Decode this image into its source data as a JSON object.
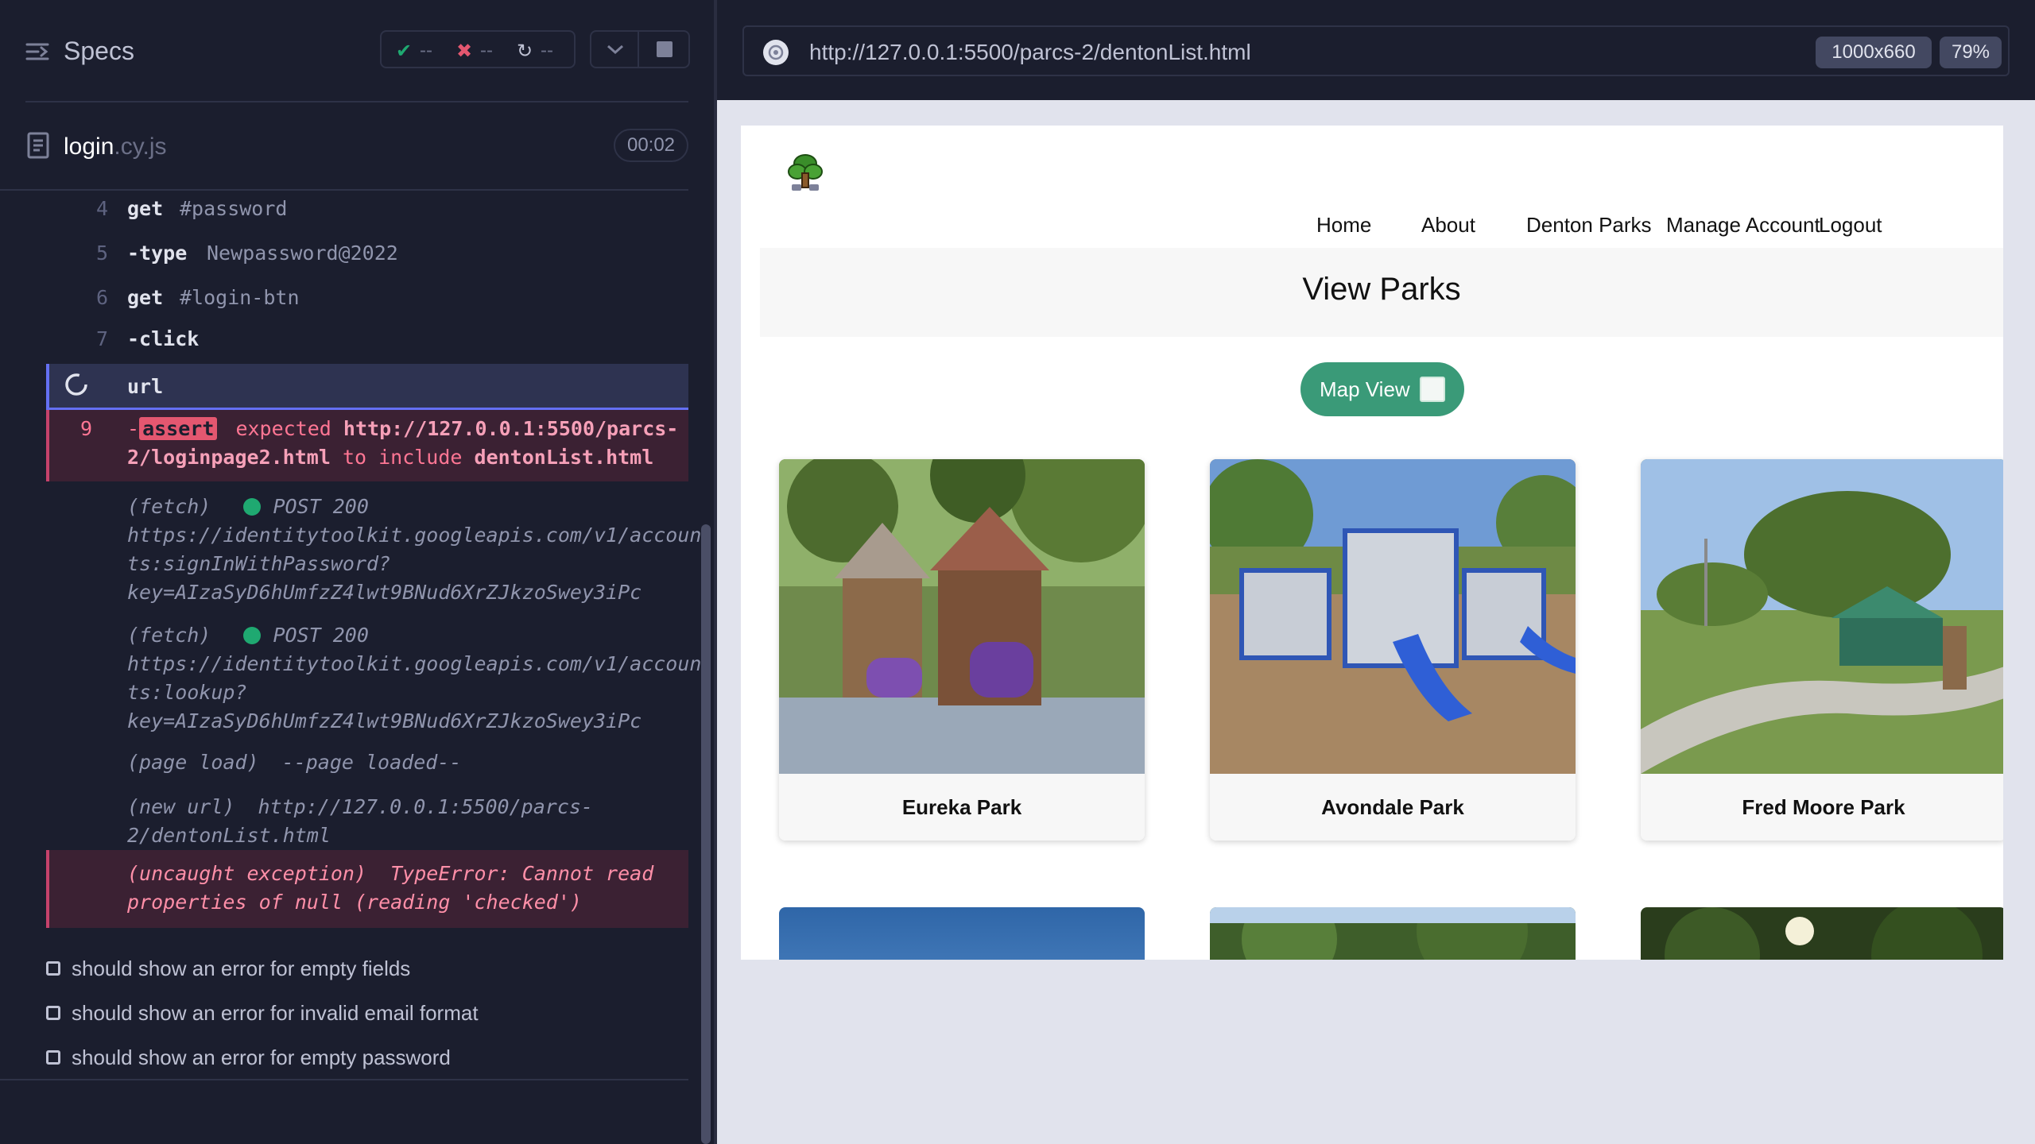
{
  "runner": {
    "specs_title": "Specs",
    "stats": {
      "passed": "--",
      "failed": "--",
      "pending": "--"
    },
    "file": {
      "name": "login",
      "ext": ".cy.js"
    },
    "timer": "00:02"
  },
  "commands": [
    {
      "num": "4",
      "name": "get",
      "arg": "#password"
    },
    {
      "num": "5",
      "name": "-type",
      "arg": "Newpassword@2022"
    },
    {
      "num": "6",
      "name": "get",
      "arg": "#login-btn"
    },
    {
      "num": "7",
      "name": "-click",
      "arg": ""
    },
    {
      "num": "",
      "name": "url",
      "arg": ""
    }
  ],
  "assert": {
    "num": "9",
    "dash": "-",
    "tag": "assert",
    "word_expected": "expected",
    "url_line1": "http://127.0.0.1:5500/parcs-",
    "url_line2": "2/loginpage2.html",
    "word_include": "to include",
    "target": "dentonList.html"
  },
  "logs": [
    {
      "type": "(fetch)",
      "status": "POST 200",
      "lines": [
        "https://identitytoolkit.googleapis.com/v1/accoun",
        "ts:signInWithPassword?",
        "key=AIzaSyD6hUmfzZ4lwt9BNud6XrZJkzoSwey3iPc"
      ]
    },
    {
      "type": "(fetch)",
      "status": "POST 200",
      "lines": [
        "https://identitytoolkit.googleapis.com/v1/accoun",
        "ts:lookup?",
        "key=AIzaSyD6hUmfzZ4lwt9BNud6XrZJkzoSwey3iPc"
      ]
    }
  ],
  "page_load": {
    "type": "(page load)",
    "text": "--page loaded--"
  },
  "new_url": {
    "type": "(new url)",
    "line1": "http://127.0.0.1:5500/parcs-",
    "line2": "2/dentonList.html"
  },
  "exception": {
    "line1": "(uncaught exception)  TypeError: Cannot read",
    "line2": "properties of null (reading 'checked')"
  },
  "tests": [
    "should show an error for empty fields",
    "should show an error for invalid email format",
    "should show an error for empty password"
  ],
  "browser": {
    "url": "http://127.0.0.1:5500/parcs-2/dentonList.html",
    "viewport": "1000x660",
    "zoom": "79%"
  },
  "site": {
    "nav": [
      "Home",
      "About",
      "Denton Parks",
      "Manage Account",
      "Logout"
    ],
    "page_title": "View Parks",
    "map_button": "Map View",
    "parks": [
      "Eureka Park",
      "Avondale Park",
      "Fred Moore Park"
    ]
  },
  "colors": {
    "accent": "#6470f3",
    "error": "#e45770",
    "pass": "#1fa971",
    "map_button": "#3a9a78"
  }
}
